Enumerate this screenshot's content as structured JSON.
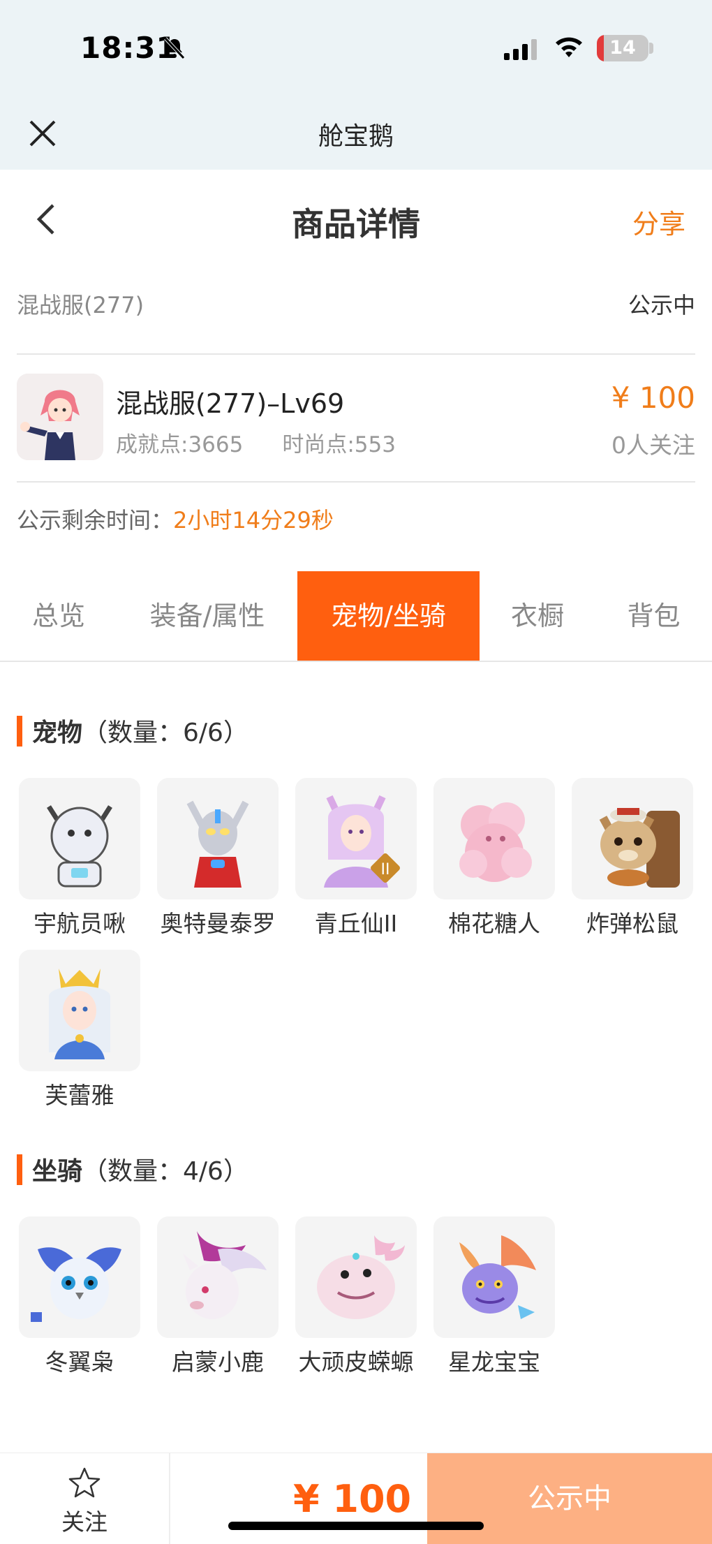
{
  "status": {
    "time": "18:31",
    "battery": "14",
    "battery_level": 0.14
  },
  "miniapp": {
    "title": "舱宝鹅"
  },
  "nav": {
    "title": "商品详情",
    "share": "分享"
  },
  "server": {
    "name": "混战服(277)",
    "status": "公示中"
  },
  "role": {
    "name": "混战服(277)–Lv69",
    "achievement": "成就点:3665",
    "fashion": "时尚点:553",
    "price": "¥ 100",
    "followers": "0人关注"
  },
  "countdown": {
    "label": "公示剩余时间：",
    "value": "2小时14分29秒"
  },
  "tabs": [
    {
      "label": "总览"
    },
    {
      "label": "装备/属性"
    },
    {
      "label": "宠物/坐骑",
      "active": true
    },
    {
      "label": "衣橱"
    },
    {
      "label": "背包"
    }
  ],
  "pets": {
    "title": "宠物",
    "count": "（数量：6/6）",
    "items": [
      {
        "name": "宇航员啾",
        "icon": "astronaut-pet-icon"
      },
      {
        "name": "奥特曼泰罗",
        "icon": "ultraman-pet-icon"
      },
      {
        "name": "青丘仙II",
        "icon": "fox-fairy-pet-icon"
      },
      {
        "name": "棉花糖人",
        "icon": "marshmallow-pet-icon"
      },
      {
        "name": "炸弹松鼠",
        "icon": "squirrel-pet-icon"
      },
      {
        "name": "芙蕾雅",
        "icon": "freya-pet-icon"
      }
    ]
  },
  "mounts": {
    "title": "坐骑",
    "count": "（数量：4/6）",
    "items": [
      {
        "name": "冬翼枭",
        "icon": "owl-mount-icon"
      },
      {
        "name": "启蒙小鹿",
        "icon": "deer-mount-icon"
      },
      {
        "name": "大顽皮蝾螈",
        "icon": "axolotl-mount-icon"
      },
      {
        "name": "星龙宝宝",
        "icon": "dragon-mount-icon"
      }
    ]
  },
  "bottom": {
    "follow": "关注",
    "price": "¥ 100",
    "action": "公示中"
  },
  "colors": {
    "accent": "#ff5f0f",
    "orange_text": "#f07d1a",
    "disabled_button": "#fdb083"
  }
}
